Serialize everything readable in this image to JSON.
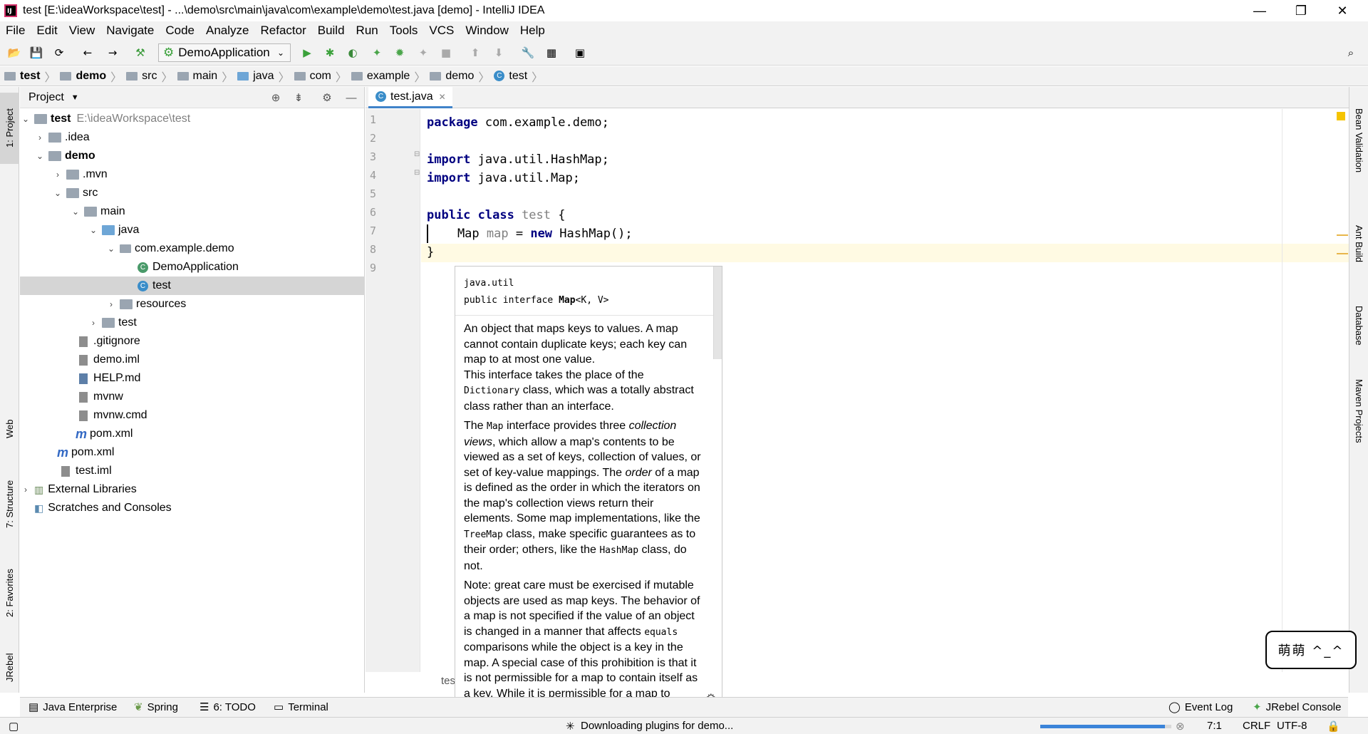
{
  "window": {
    "title": "test [E:\\ideaWorkspace\\test] - ...\\demo\\src\\main\\java\\com\\example\\demo\\test.java [demo] - IntelliJ IDEA",
    "app_logo": "IJ"
  },
  "menu": [
    "File",
    "Edit",
    "View",
    "Navigate",
    "Code",
    "Analyze",
    "Refactor",
    "Build",
    "Run",
    "Tools",
    "VCS",
    "Window",
    "Help"
  ],
  "toolbar": {
    "run_config": "DemoApplication"
  },
  "breadcrumb": [
    "test",
    "demo",
    "src",
    "main",
    "java",
    "com",
    "example",
    "demo",
    "test"
  ],
  "left_tabs": {
    "project": "1: Project",
    "web": "Web",
    "structure": "7: Structure",
    "favorites": "2: Favorites",
    "jrebel": "JRebel"
  },
  "right_tabs": {
    "bean": "Bean Validation",
    "ant": "Ant Build",
    "database": "Database",
    "maven": "Maven Projects"
  },
  "project": {
    "header": "Project",
    "tree": [
      {
        "label": "test",
        "extra": "E:\\ideaWorkspace\\test"
      },
      {
        "label": ".idea"
      },
      {
        "label": "demo"
      },
      {
        "label": ".mvn"
      },
      {
        "label": "src"
      },
      {
        "label": "main"
      },
      {
        "label": "java"
      },
      {
        "label": "com.example.demo"
      },
      {
        "label": "DemoApplication"
      },
      {
        "label": "test"
      },
      {
        "label": "resources"
      },
      {
        "label": "test"
      },
      {
        "label": ".gitignore"
      },
      {
        "label": "demo.iml"
      },
      {
        "label": "HELP.md"
      },
      {
        "label": "mvnw"
      },
      {
        "label": "mvnw.cmd"
      },
      {
        "label": "pom.xml"
      },
      {
        "label": "pom.xml"
      },
      {
        "label": "test.iml"
      },
      {
        "label": "External Libraries"
      },
      {
        "label": "Scratches and Consoles"
      }
    ]
  },
  "editor": {
    "tab": "test.java",
    "lines": [
      "1",
      "2",
      "3",
      "4",
      "5",
      "6",
      "7",
      "8",
      "9"
    ],
    "code": {
      "l1_kw": "package",
      "l1_rest": " com.example.demo;",
      "l3_kw": "import",
      "l3_rest": " java.util.HashMap;",
      "l4_kw": "import",
      "l4_rest": " java.util.Map;",
      "l6_kw": "public class",
      "l6_name": " test",
      "l6_rest": " {",
      "l7_indent": "    Map ",
      "l7_var": "map",
      "l7_mid": " = ",
      "l7_kw": "new",
      "l7_rest": " HashMap();",
      "l8": "}"
    },
    "breadcrumb_bottom": "test"
  },
  "doc_popup": {
    "package": "java.util",
    "signature_pre": "public interface ",
    "signature_name": "Map",
    "signature_post": "<K, V>",
    "p1a": "An object that maps keys to values. A map cannot contain duplicate keys; each key can map to at most one value.",
    "p1b": "This interface takes the place of the",
    "p1c_code": "Dictionary",
    "p1d": " class, which was a totally abstract class rather than an interface.",
    "p2a": "The ",
    "p2b_code": "Map",
    "p2c": " interface provides three ",
    "p2d_em": "collection views",
    "p2e": ", which allow a map's contents to be viewed as a set of keys, collection of values, or set of key-value mappings. The ",
    "p2f_em": "order",
    "p2g": " of a map is defined as the order in which the iterators on the map's collection views return their elements. Some map implementations, like the ",
    "p2h_code": "TreeMap",
    "p2i": " class, make specific guarantees as to their order; others, like the ",
    "p2j_code": "HashMap",
    "p2k": " class, do not.",
    "p3a": "Note: great care must be exercised if mutable objects are used as map keys. The behavior of a map is not specified if the value of an object is changed in a manner that affects ",
    "p3b_code": "equals",
    "p3c": " comparisons while the object is a key in the map. A special case of this prohibition is that it is not permissible for a map to contain itself as a key. While it is permissible for a map to contain itself as a"
  },
  "bottom_tabs": {
    "java_enterprise": "Java Enterprise",
    "spring": "Spring",
    "todo": "6: TODO",
    "terminal": "Terminal",
    "event_log": "Event Log",
    "jrebel_console": "JRebel Console"
  },
  "status": {
    "message": "Downloading plugins for demo...",
    "position": "7:1",
    "line_sep": "CRLF",
    "encoding": "UTF-8",
    "progress": 0.95
  },
  "sticker": {
    "text": "萌萌 ^_^"
  }
}
